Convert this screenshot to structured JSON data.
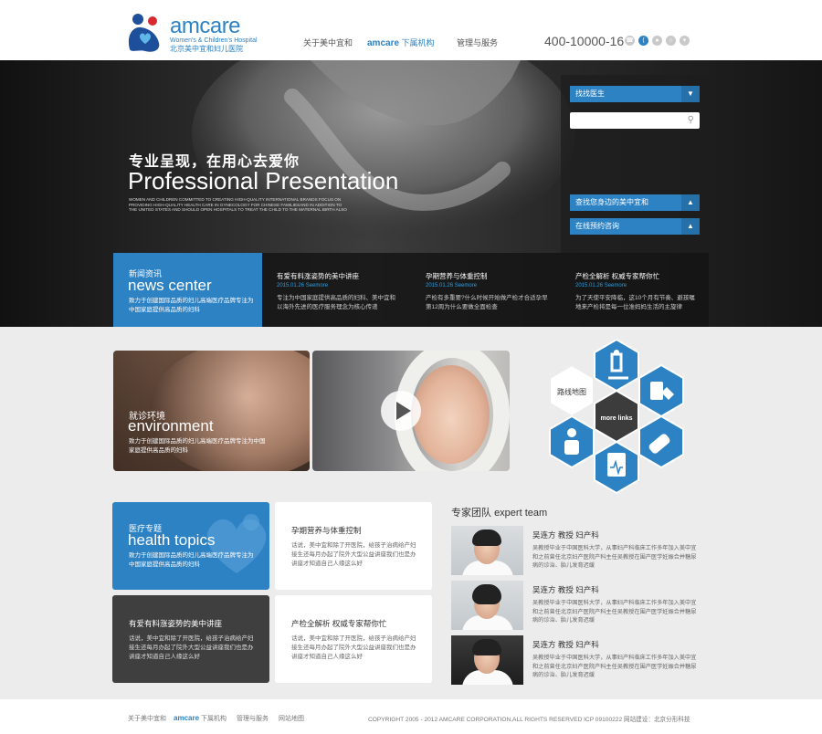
{
  "brand": {
    "name": "amcare",
    "subtitle": "Women's & Children's Hospital",
    "chinese": "北京美中宜和妇儿医院",
    "color": "#2d82c4"
  },
  "nav": {
    "item1": "关于美中宜和",
    "item2_brand": "amcare",
    "item2_rest": "下属机构",
    "item3": "管理与服务"
  },
  "phone": "400-10000-16",
  "header_icons": [
    "phone-icon",
    "share-icon",
    "weibo-icon",
    "wechat-icon",
    "location-icon"
  ],
  "hero": {
    "title_cn": "专业呈现，在用心去爱你",
    "title_en": "Professional Presentation",
    "small_text": "WOMEN AND CHILDREN COMMITTED TO CREATING HIGH-QUALITY INTERNATIONAL BRANDS FOCUS ON PROVIDING HIGH-QUALITY HEALTH CARE IN GYNECOLOGY FOR CHINESE FAMILIESAND IN ADDITION TO THE UNITED STATES AND SHOULD OPEN HOSPITALS TO TREAT THE CHILD TO THE MATERNAL BIRTH ALSO"
  },
  "side_panel": {
    "find_doctor": "找找医生",
    "search_placeholder": "",
    "find_nearby": "查找您身边的美中宜和",
    "online_consult": "在线预约咨询"
  },
  "news": {
    "center_cn": "新闻资讯",
    "center_en": "news center",
    "center_desc": "致力于创建国际品质的妇儿高端医疗品牌专注为中国家庭提供高品质的妇科",
    "items": [
      {
        "title": "有爱有料涨姿势的美中讲座",
        "date": "2015.01.26 Seemore",
        "desc": "专注为中国家庭提供高品质的妇科、美中宜和以海外先进的医疗服务理念为核心传递"
      },
      {
        "title": "孕期营养与体重控制",
        "date": "2015.01.26 Seemore",
        "desc": "产检有多重要?什么时候开始做产检才合适孕早第12周为什么要做全面检查"
      },
      {
        "title": "产检全解析 权威专家帮你忙",
        "date": "2015.01.26 Seemore",
        "desc": "为了天使平安降临，这10个月有节奏、避孩嘱地来产检将是每一位准妈妈生活的主旋律"
      }
    ]
  },
  "environment": {
    "cn": "就诊环境",
    "en": "environment",
    "desc": "致力于创建国际品质的妇儿高端医疗品牌专注为中国家庭提供高品质的妇科"
  },
  "hex_menu": {
    "route_map": "路线地图",
    "more_links": "more links"
  },
  "health_topics": {
    "cn": "医疗专题",
    "en": "health topics",
    "desc": "致力于创建国际品质的妇儿高端医疗品牌专注为中国家庭提供高品质的妇科"
  },
  "topic_cards": [
    {
      "title": "孕期营养与体重控制",
      "desc": "话说，美中宜和除了开医院，给孩子治病给产妇接生还每月办起了院外大型公益讲座我们也是办讲座才知道自己人缘这么好"
    },
    {
      "title": "有爱有料涨姿势的美中讲座",
      "desc": "话说，美中宜和除了开医院，给孩子治病给产妇接生还每月办起了院外大型公益讲座我们也是办讲座才知道自己人缘这么好"
    },
    {
      "title": "产检全解析 权威专家帮你忙",
      "desc": "话说，美中宜和除了开医院，给孩子治病给产妇接生还每月办起了院外大型公益讲座我们也是办讲座才知道自己人缘这么好"
    }
  ],
  "team": {
    "title_cn": "专家团队",
    "title_en": "expert team",
    "experts": [
      {
        "name": "吴连方 教授 妇产科",
        "desc": "吴教授毕业于中国医科大学，从事妇产科临床工作多年加入美中宜和之前曾任北京妇产医院产科主任吴教授在围产医学妊娠合并糖尿病的诊治、胎儿发育迟缓"
      },
      {
        "name": "吴连方 教授 妇产科",
        "desc": "吴教授毕业于中国医科大学，从事妇产科临床工作多年加入美中宜和之前曾任北京妇产医院产科主任吴教授在围产医学妊娠合并糖尿病的诊治、胎儿发育迟缓"
      },
      {
        "name": "吴连方 教授 妇产科",
        "desc": "吴教授毕业于中国医科大学，从事妇产科临床工作多年加入美中宜和之前曾任北京妇产医院产科主任吴教授在围产医学妊娠合并糖尿病的诊治、胎儿发育迟缓"
      }
    ]
  },
  "footer": {
    "link1": "关于美中宜和",
    "link2_brand": "amcare",
    "link2_rest": "下属机构",
    "link3": "管理与服务",
    "link4": "网站地图",
    "copyright": "COPYRIGHT 2005 - 2012 AMCARE CORPORATION,ALL RIGHTS RESERVED  ICP 09100222    网站建设：北京分形科技"
  }
}
